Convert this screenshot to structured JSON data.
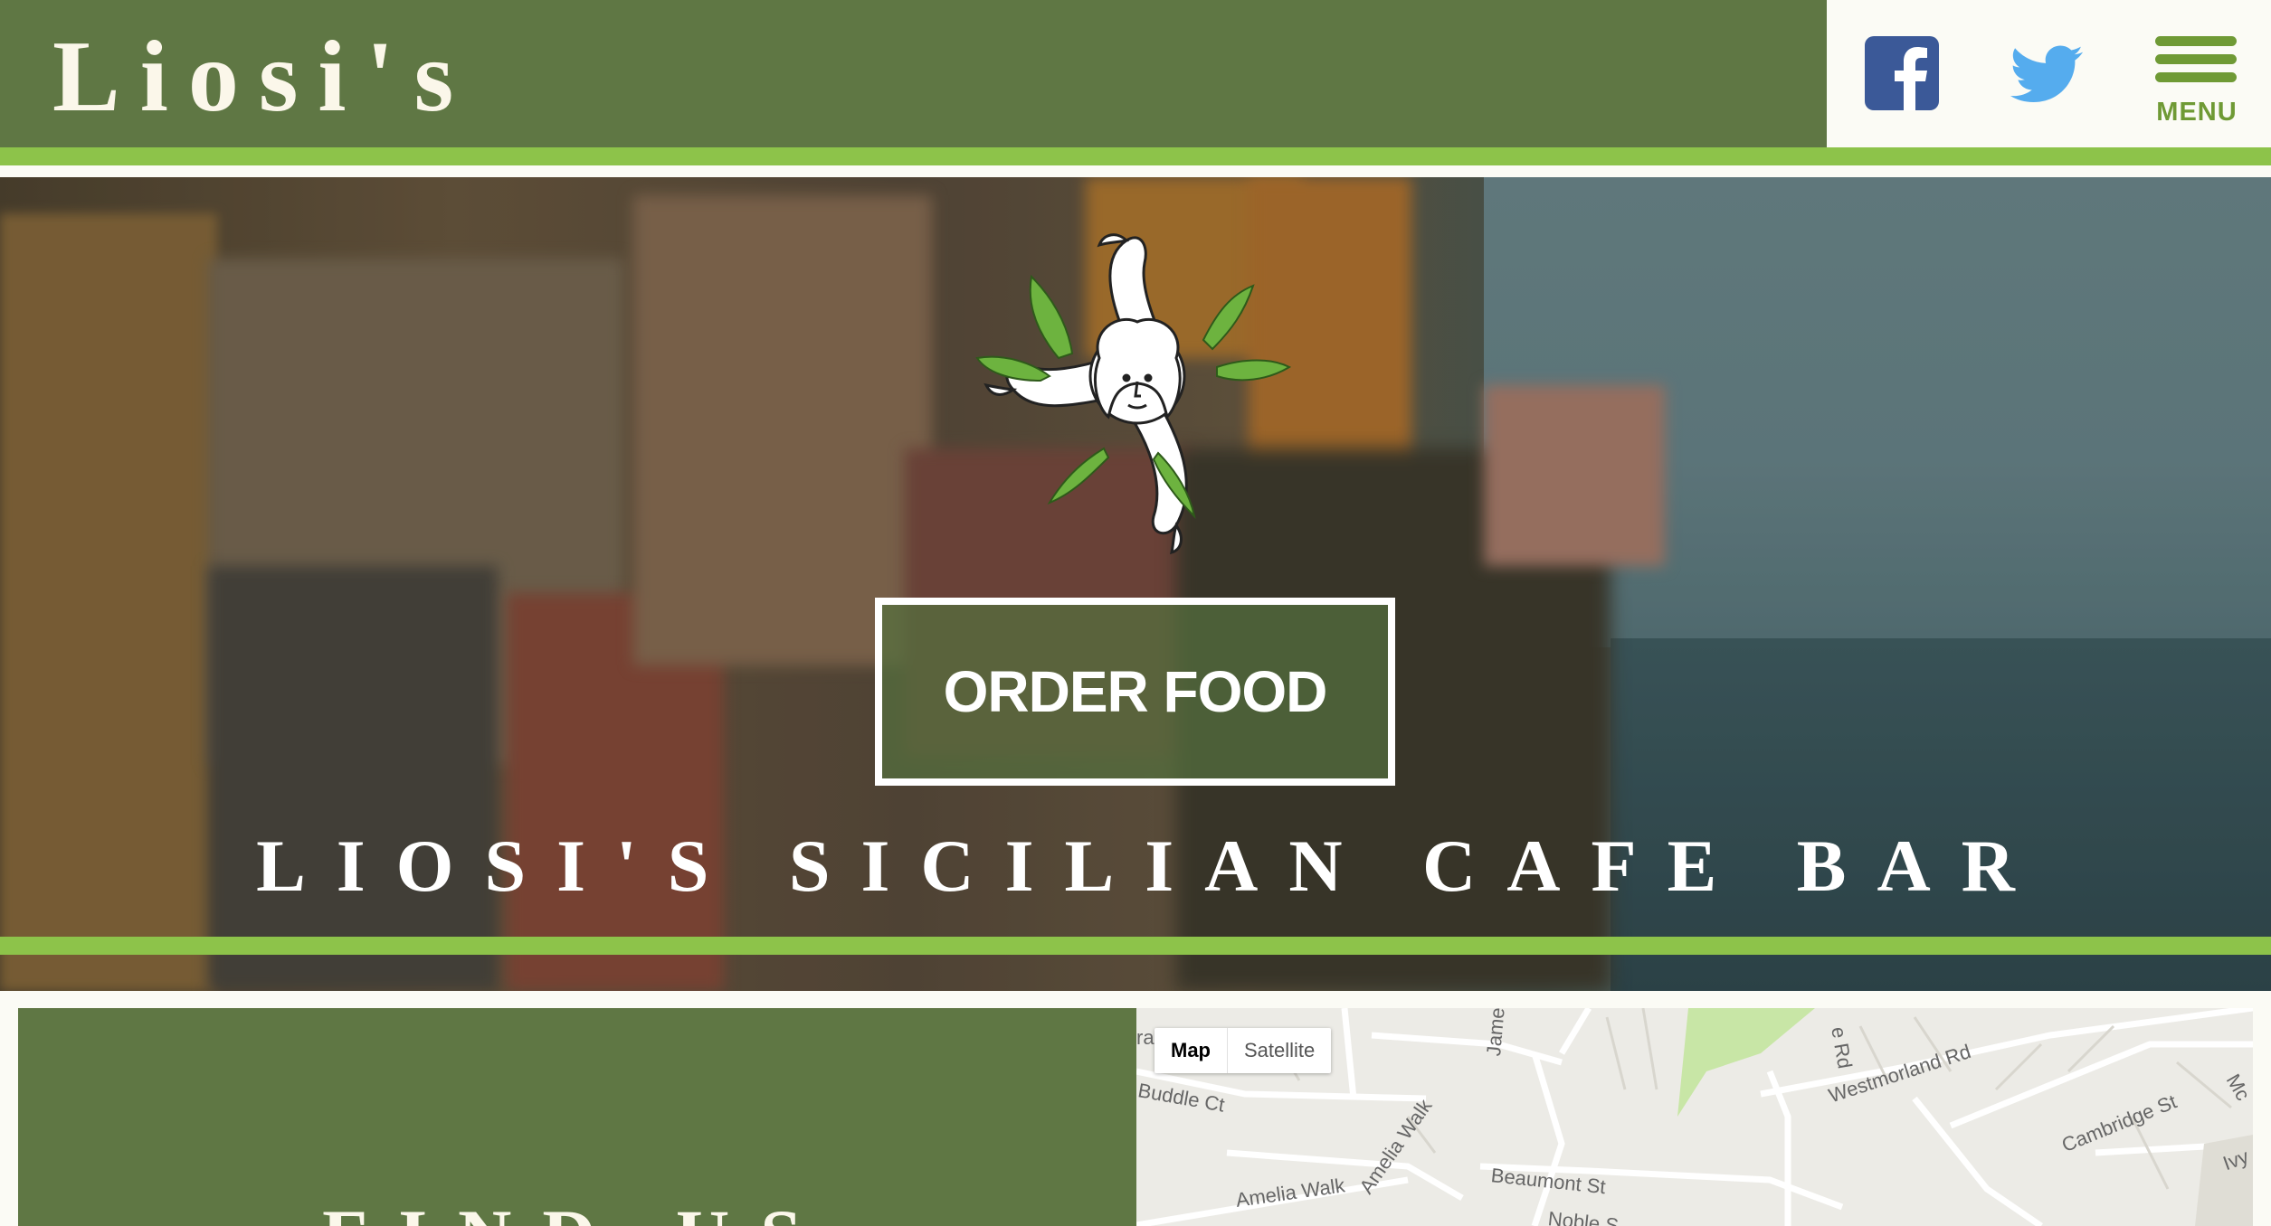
{
  "header": {
    "logo_text": "Liosi's",
    "menu_label": "MENU",
    "social": [
      "facebook-icon",
      "twitter-icon"
    ]
  },
  "hero": {
    "order_button_label": "ORDER FOOD",
    "tagline": "LIOSI'S SICILIAN CAFE BAR"
  },
  "find_us": {
    "title": "FIND US"
  },
  "map": {
    "toggle": {
      "map_label": "Map",
      "satellite_label": "Satellite"
    },
    "streets": [
      "ra",
      "Buddle Ct",
      "Jame",
      "e Rd",
      "Westmorland Rd",
      "Cambridge St",
      "Amelia Walk",
      "Amelia Walk",
      "Beaumont St",
      "Noble S",
      "Ivy",
      "Mc"
    ]
  },
  "colors": {
    "brand_green": "#5f7744",
    "accent_green": "#8dc34a",
    "menu_green": "#6f9a35",
    "facebook_blue": "#3b5998",
    "twitter_blue": "#55acee"
  }
}
